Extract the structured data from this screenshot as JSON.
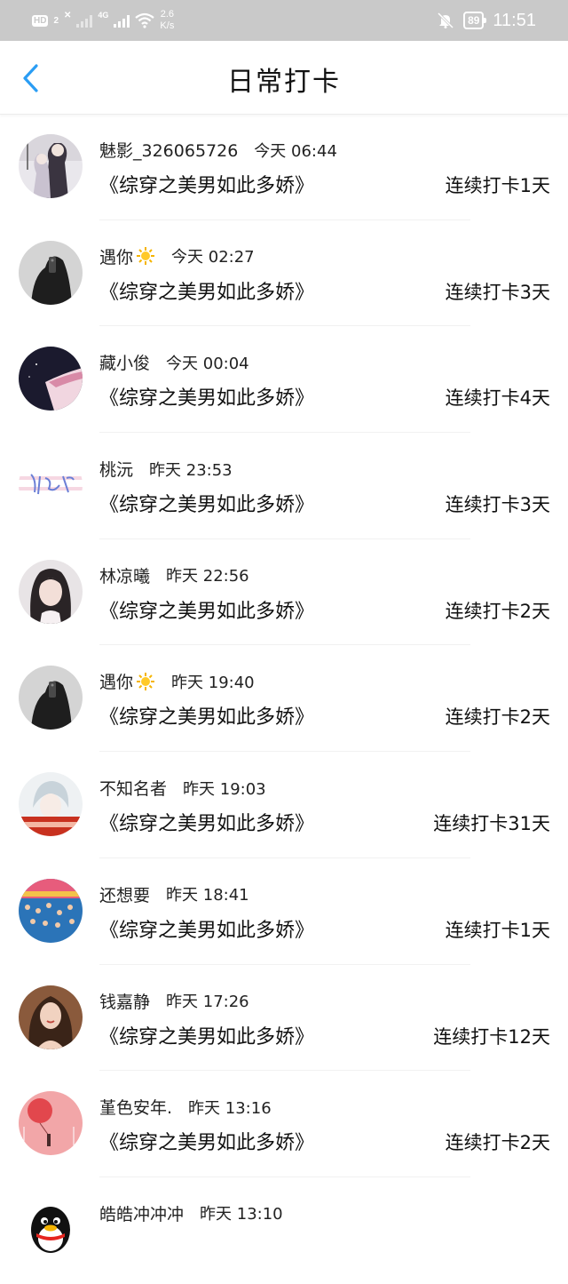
{
  "status_bar": {
    "hd": "HD",
    "sim": "2",
    "network": "4G",
    "speed_value": "2.6",
    "speed_unit": "K/s",
    "battery": "89",
    "time": "11:51"
  },
  "header": {
    "title": "日常打卡"
  },
  "items": [
    {
      "name": "魅影_326065726",
      "time": "今天 06:44",
      "book": "《综穿之美男如此多娇》",
      "streak": "连续打卡1天",
      "avatar": "couple-photo",
      "emoji": ""
    },
    {
      "name": "遇你",
      "time": "今天 02:27",
      "book": "《综穿之美男如此多娇》",
      "streak": "连续打卡3天",
      "avatar": "mirror-selfie",
      "emoji": "sun"
    },
    {
      "name": "藏小俊",
      "time": "今天 00:04",
      "book": "《综穿之美男如此多娇》",
      "streak": "连续打卡4天",
      "avatar": "night-sky",
      "emoji": ""
    },
    {
      "name": "桃沅",
      "time": "昨天 23:53",
      "book": "《综穿之美男如此多娇》",
      "streak": "连续打卡3天",
      "avatar": "text-logo",
      "emoji": ""
    },
    {
      "name": "林凉曦",
      "time": "昨天 22:56",
      "book": "《综穿之美男如此多娇》",
      "streak": "连续打卡2天",
      "avatar": "girl-portrait",
      "emoji": ""
    },
    {
      "name": "遇你",
      "time": "昨天 19:40",
      "book": "《综穿之美男如此多娇》",
      "streak": "连续打卡2天",
      "avatar": "mirror-selfie",
      "emoji": "sun"
    },
    {
      "name": "不知名者",
      "time": "昨天 19:03",
      "book": "《综穿之美男如此多娇》",
      "streak": "连续打卡31天",
      "avatar": "anime-boy",
      "emoji": ""
    },
    {
      "name": "还想要",
      "time": "昨天 18:41",
      "book": "《综穿之美男如此多娇》",
      "streak": "连续打卡1天",
      "avatar": "pool-crowd",
      "emoji": ""
    },
    {
      "name": "钱嘉静",
      "time": "昨天 17:26",
      "book": "《综穿之美男如此多娇》",
      "streak": "连续打卡12天",
      "avatar": "woman-portrait",
      "emoji": ""
    },
    {
      "name": "堇色安年.",
      "time": "昨天 13:16",
      "book": "《综穿之美男如此多娇》",
      "streak": "连续打卡2天",
      "avatar": "red-balloon",
      "emoji": ""
    },
    {
      "name": "皓皓冲冲冲",
      "time": "昨天 13:10",
      "book": "",
      "streak": "",
      "avatar": "qq-penguin",
      "emoji": ""
    }
  ],
  "colors": {
    "accent": "#2a9df4",
    "status_bar_bg": "#c9c9c9",
    "divider": "#f1f1f1"
  }
}
